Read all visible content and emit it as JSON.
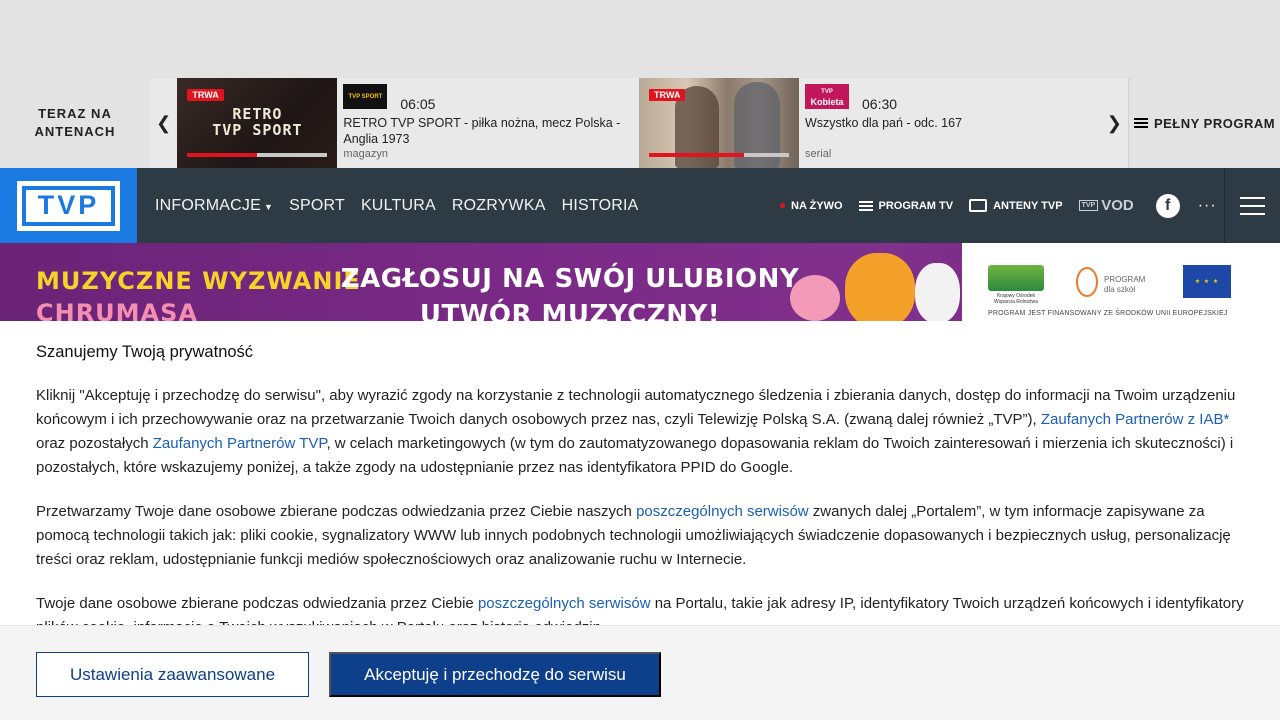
{
  "on_air": {
    "label_line1": "TERAZ NA",
    "label_line2": "ANTENACH",
    "prev_arrow": "‹",
    "next_arrow": "›",
    "programs": [
      {
        "live_badge": "TRWA",
        "thumb_text_line1": "RETRO",
        "thumb_text_line2": "TVP SPORT",
        "channel_logo": "TVP SPORT",
        "time": "06:05",
        "title": "RETRO TVP SPORT - piłka nożna, mecz Polska - Anglia 1973",
        "genre": "magazyn",
        "progress": 0.5
      },
      {
        "live_badge": "TRWA",
        "channel_logo": "Kobieta",
        "channel_logo_small": "TVP",
        "time": "06:30",
        "title": "Wszystko dla pań - odc. 167",
        "genre": "serial",
        "progress": 0.68
      }
    ],
    "full_program": "PEŁNY PROGRAM"
  },
  "nav": {
    "logo": "TVP",
    "menu": [
      {
        "label": "INFORMACJE",
        "has_dropdown": true
      },
      {
        "label": "SPORT"
      },
      {
        "label": "KULTURA"
      },
      {
        "label": "ROZRYWKA"
      },
      {
        "label": "HISTORIA"
      }
    ],
    "live": "NA ŻYWO",
    "program_tv": "PROGRAM TV",
    "antennas": "ANTENY TVP",
    "vod_small": "TVP",
    "vod": "VOD",
    "facebook": "f",
    "more": "···"
  },
  "banner": {
    "left_line1": "MUZYCZNE WYZWANIE",
    "left_line2": "CHRUMASA",
    "mid_line1": "ZAGŁOSUJ NA SWÓJ ULUBIONY",
    "mid_line2": "UTWÓR MUZYCZNY!",
    "sponsor1": "Krajowy Ośrodek Wsparcia Rolnictwa",
    "sponsor2_line1": "PROGRAM",
    "sponsor2_line2": "dla szkół",
    "footer": "PROGRAM JEST FINANSOWANY ZE ŚRODKÓW UNII EUROPEJSKIEJ",
    "colors": {
      "purple": "#7a2a86",
      "yellow": "#f7d227"
    }
  },
  "consent": {
    "title": "Szanujemy Twoją prywatność",
    "p1_a": "Kliknij \"Akceptuję i przechodzę do serwisu\", aby wyrazić zgody na korzystanie z technologii automatycznego śledzenia i zbierania danych, dostęp do informacji na Twoim urządzeniu końcowym i ich przechowywanie oraz na przetwarzanie Twoich danych osobowych przez nas, czyli Telewizję Polską S.A. (zwaną dalej również „TVP”), ",
    "p1_link1": "Zaufanych Partnerów z IAB*",
    "p1_b": " oraz pozostałych ",
    "p1_link2": "Zaufanych Partnerów TVP",
    "p1_c": ", w celach marketingowych (w tym do zautomatyzowanego dopasowania reklam do Twoich zainteresowań i mierzenia ich skuteczności) i pozostałych, które wskazujemy poniżej, a także zgody na udostępnianie przez nas identyfikatora PPID do Google.",
    "p2_a": "Przetwarzamy Twoje dane osobowe zbierane podczas odwiedzania przez Ciebie naszych ",
    "p2_link": "poszczególnych serwisów",
    "p2_b": " zwanych dalej „Portalem”, w tym informacje zapisywane za pomocą technologii takich jak: pliki cookie, sygnalizatory WWW lub innych podobnych technologii umożliwiających świadczenie dopasowanych i bezpiecznych usług, personalizację treści oraz reklam, udostępnianie funkcji mediów społecznościowych oraz analizowanie ruchu w Internecie.",
    "p3_a": "Twoje dane osobowe zbierane podczas odwiedzania przez Ciebie ",
    "p3_link": "poszczególnych serwisów",
    "p3_b": " na Portalu, takie jak adresy IP, identyfikatory Twoich urządzeń końcowych i identyfikatory plików cookie, informacje o Twoich wyszukiwaniach w Portalu oraz historia odwiedzin.",
    "btn_advanced": "Ustawienia zaawansowane",
    "btn_accept": "Akceptuję i przechodzę do serwisu",
    "colors": {
      "primary": "#0d3f8a",
      "link": "#1a5fb4"
    }
  }
}
